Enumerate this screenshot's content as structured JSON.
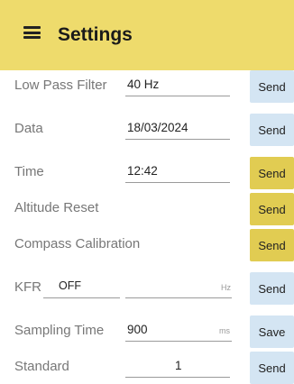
{
  "header": {
    "title": "Settings",
    "menu_icon": "hamburger-menu-icon"
  },
  "rows": [
    {
      "label": "Low Pass Filter",
      "value": "40 Hz",
      "button": "Send"
    },
    {
      "label": "Data",
      "value": "18/03/2024",
      "button": "Send"
    },
    {
      "label": "Time",
      "value": "12:42",
      "button": "Send"
    },
    {
      "label": "Altitude Reset",
      "button": "Send"
    },
    {
      "label": "Compass Calibration",
      "button": "Send"
    },
    {
      "label": "KFR",
      "toggle_value": "OFF",
      "value": "",
      "unit": "Hz",
      "button": "Send"
    },
    {
      "label": "Sampling Time",
      "value": "900",
      "unit": "ms",
      "button": "Save"
    },
    {
      "label": "Standard",
      "value": "1",
      "button": "Send"
    }
  ],
  "colors": {
    "appbar": "#eedb6c",
    "button_blue": "#d4e5f3",
    "button_yellow": "#e1cc52"
  }
}
